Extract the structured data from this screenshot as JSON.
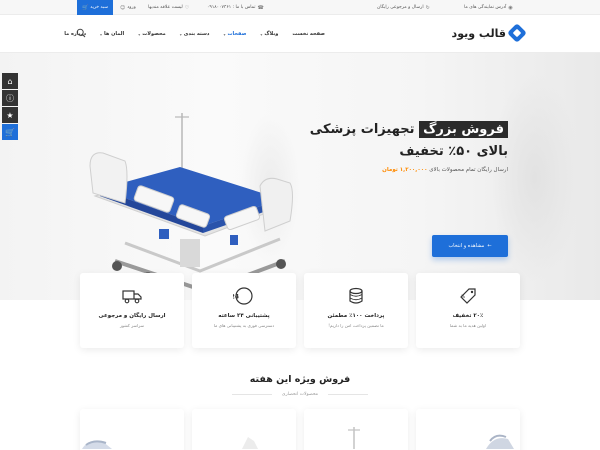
{
  "topbar": {
    "cart_label": "سبد خرید",
    "login_label": "ورود",
    "wishlist_label": "لیست علاقه مندیها",
    "phone_label": "تماس با ما : ۰۹۱۸۰۰۷۳۶۱",
    "shipping_label": "ارسال و مرجوعی رایگان",
    "stores_label": "آدرس نمایندگی های ما"
  },
  "header": {
    "logo_text": "قالب ویود",
    "nav": [
      {
        "label": "صفحه نخست",
        "dropdown": false,
        "active": false
      },
      {
        "label": "وبلاگ",
        "dropdown": true,
        "active": false
      },
      {
        "label": "صفحات",
        "dropdown": true,
        "active": true
      },
      {
        "label": "دسته بندی",
        "dropdown": true,
        "active": false
      },
      {
        "label": "محصولات",
        "dropdown": true,
        "active": false
      },
      {
        "label": "المان ها",
        "dropdown": true,
        "active": false
      },
      {
        "label": "درباره ما",
        "dropdown": false,
        "active": false
      }
    ]
  },
  "dock": {
    "icons": [
      "home-icon",
      "info-icon",
      "star-icon",
      "cart-icon"
    ]
  },
  "hero": {
    "title_highlight": "فروش بزرگ",
    "title_rest": "تجهیزات پزشکی",
    "title_line2": "بالای ۵۰٪ تخفیف",
    "subtitle": "ارسال رایگان تمام محصولات بالای",
    "price": "۱,۲۰۰,۰۰۰ تومان",
    "button_label": "مشاهده و انتخاب"
  },
  "features": [
    {
      "title": "۲۰٪ تخفیف",
      "desc": "اولین هدیه ما به شما",
      "icon": "discount-tag-icon"
    },
    {
      "title": "پرداخت ۱۰۰٪ مطمئن",
      "desc": "ما تضمین پرداخت امن را داریم!",
      "icon": "coins-icon"
    },
    {
      "title": "پشتیبانی ۲۴ ساعته",
      "desc": "دسترسی فوری به پشتیبانی های ما",
      "icon": "support-24-icon"
    },
    {
      "title": "ارسال رایگان و مرجوعی",
      "desc": "سراسر کشور",
      "icon": "truck-icon"
    }
  ],
  "weekly": {
    "title": "فروش ویژه این هفته",
    "subtitle": "محصولات انحصاری"
  },
  "colors": {
    "accent": "#1e6fd9",
    "price": "#ff8a00",
    "dark": "#2b2b2b"
  }
}
